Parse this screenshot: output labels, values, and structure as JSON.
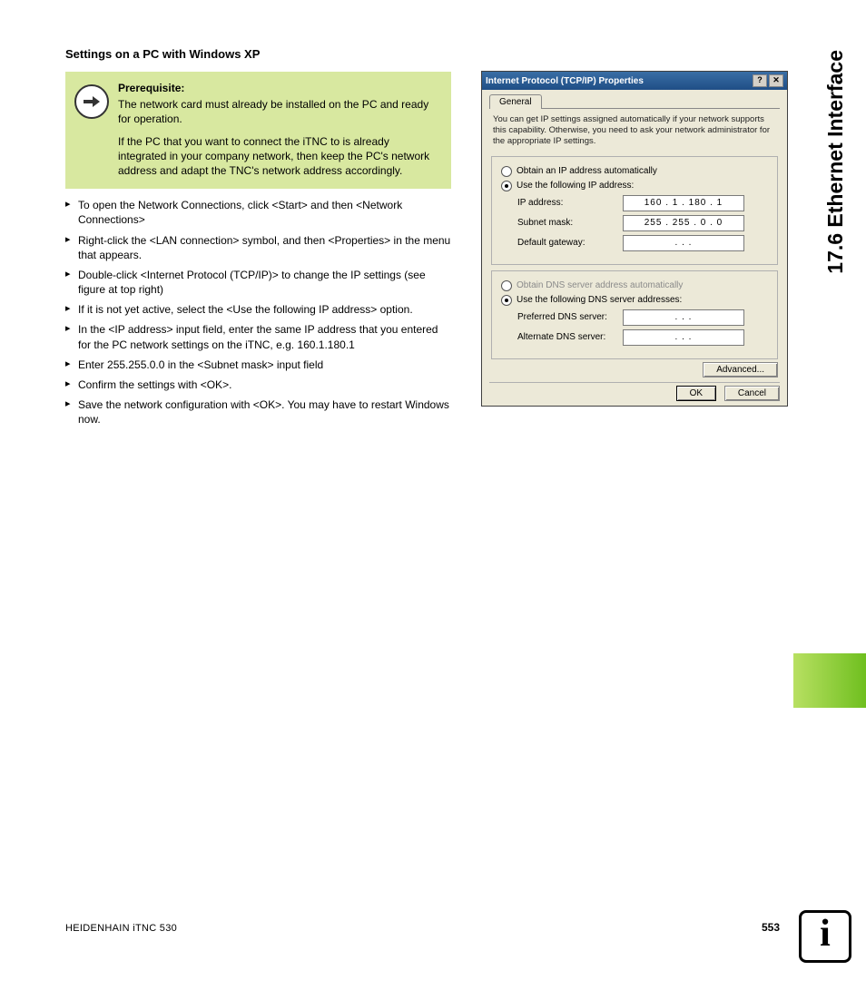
{
  "sideTitle": "17.6 Ethernet Interface",
  "heading": "Settings on a PC with Windows XP",
  "note": {
    "title": "Prerequisite:",
    "p1": "The network card must already be installed on the PC and ready for operation.",
    "p2": "If the PC that you want to connect the iTNC to is already integrated in your company network, then keep the PC's network address and adapt the TNC's network address accordingly."
  },
  "steps": [
    "To open the Network Connections, click <Start> and then <Network Connections>",
    "Right-click the <LAN connection> symbol, and then <Properties> in the menu that appears.",
    "Double-click <Internet Protocol (TCP/IP)> to change the IP settings (see figure at top right)",
    "If it is not yet active, select the <Use the following IP address> option.",
    "In the <IP address> input field, enter the same IP address that you entered for the PC network settings on the iTNC, e.g. 160.1.180.1",
    "Enter 255.255.0.0 in the <Subnet mask> input field",
    "Confirm the settings with <OK>.",
    "Save the network configuration with <OK>. You may have to restart Windows now."
  ],
  "dialog": {
    "title": "Internet Protocol (TCP/IP) Properties",
    "tab": "General",
    "intro": "You can get IP settings assigned automatically if your network supports this capability. Otherwise, you need to ask your network administrator for the appropriate IP settings.",
    "radioAuto": "Obtain an IP address automatically",
    "radioManual": "Use the following IP address:",
    "ipLabel": "IP address:",
    "ipValue": "160 .   1  . 180 .   1",
    "subnetLabel": "Subnet mask:",
    "subnetValue": "255 . 255 .   0  .   0",
    "gatewayLabel": "Default gateway:",
    "gatewayValue": ".       .       .",
    "dnsAuto": "Obtain DNS server address automatically",
    "dnsManual": "Use the following DNS server addresses:",
    "prefDns": "Preferred DNS server:",
    "altDns": "Alternate DNS server:",
    "blank": ".       .       .",
    "advanced": "Advanced...",
    "ok": "OK",
    "cancel": "Cancel",
    "help": "?",
    "close": "✕"
  },
  "footer": {
    "left": "HEIDENHAIN iTNC 530",
    "page": "553"
  }
}
